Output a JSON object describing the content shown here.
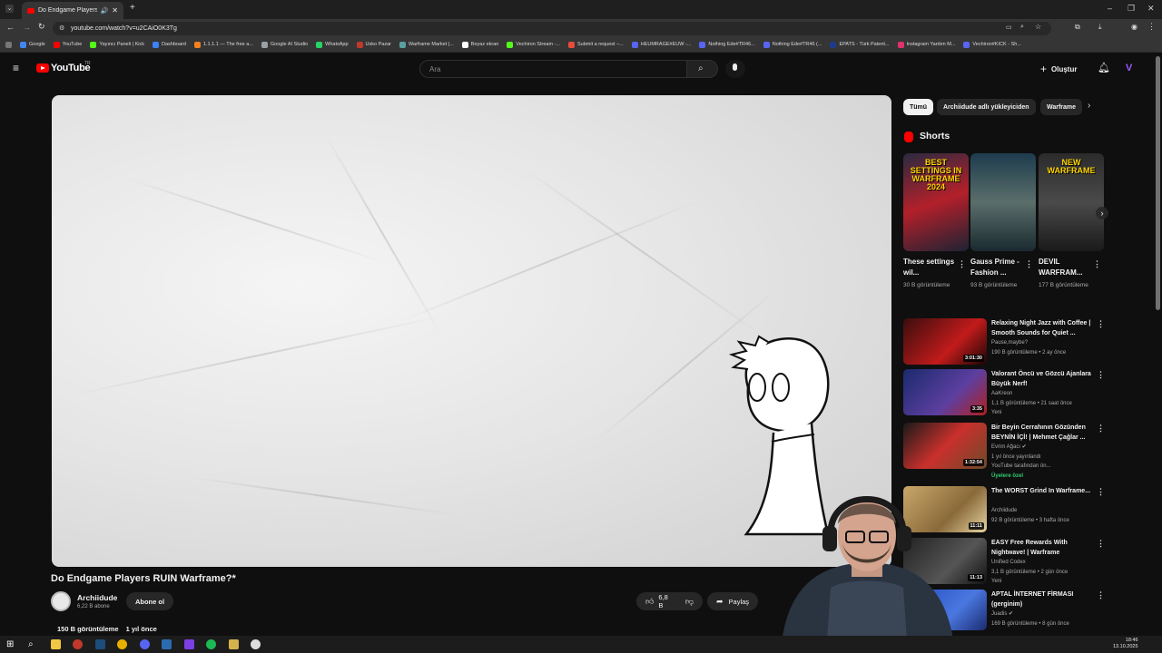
{
  "browser": {
    "tab_title": "Do Endgame Players RUIN",
    "url": "youtube.com/watch?v=u2CAiO0K3Tg",
    "bookmarks": [
      {
        "label": "Google",
        "color": "#4285f4"
      },
      {
        "label": "YouTube",
        "color": "#ff0000"
      },
      {
        "label": "Yayıncı Paneli | Kick",
        "color": "#53fc18"
      },
      {
        "label": "Dashboard",
        "color": "#3b82f6"
      },
      {
        "label": "1.1.1.1 — The free a...",
        "color": "#f38020"
      },
      {
        "label": "Google AI Studio",
        "color": "#9aa0a6"
      },
      {
        "label": "WhatsApp",
        "color": "#25d366"
      },
      {
        "label": "Usko Pazar",
        "color": "#c0392b"
      },
      {
        "label": "Warframe Market |...",
        "color": "#5aa0a0"
      },
      {
        "label": "Beyaz ekran",
        "color": "#ffffff"
      },
      {
        "label": "Vechiron Stream -...",
        "color": "#53fc18"
      },
      {
        "label": "Submit a request –...",
        "color": "#e74c3c"
      },
      {
        "label": "HEUMRAGE#EUW -...",
        "color": "#5865f2"
      },
      {
        "label": "Nothing Ede#TR46...",
        "color": "#5865f2"
      },
      {
        "label": "Nothing Ede#TR46 (...",
        "color": "#5865f2"
      },
      {
        "label": "EPATS - Türk Patent...",
        "color": "#1e3a8a"
      },
      {
        "label": "Instagram Yardım M...",
        "color": "#e1306c"
      },
      {
        "label": "Vechiron#KICK - Sh...",
        "color": "#5865f2"
      }
    ]
  },
  "header": {
    "logo": "YouTube",
    "country": "TR",
    "search_placeholder": "Ara",
    "create_label": "Oluştur"
  },
  "video": {
    "title": "Do Endgame Players RUIN Warframe?*",
    "channel": "Archiidude",
    "subscribers": "6,22 B abone",
    "subscribe_label": "Abone ol",
    "likes": "6,8 B",
    "share_label": "Paylaş",
    "views": "150 B görüntüleme",
    "age": "1 yıl önce"
  },
  "chips": [
    "Tümü",
    "Archiidude adlı yükleyiciden",
    "Warframe"
  ],
  "shorts": {
    "heading": "Shorts",
    "items": [
      {
        "title": "These settings wil...",
        "views": "30 B görüntüleme",
        "overlay": "BEST SETTINGS IN WARFRAME 2024"
      },
      {
        "title": "Gauss Prime - Fashion ...",
        "views": "93 B görüntüleme",
        "overlay": ""
      },
      {
        "title": "DEVIL WARFRAM...",
        "views": "177 B görüntüleme",
        "overlay": "NEW WARFRAME"
      }
    ]
  },
  "recommendations": [
    {
      "title": "Relaxing Night Jazz with Coffee | Smooth Sounds for Quiet ...",
      "channel": "Pause,maybe?",
      "stats": "190 B görüntüleme • 2 ay önce",
      "extra": "",
      "duration": "3:01:30"
    },
    {
      "title": "Valorant Öncü ve Gözcü Ajanlara Büyük Nerf!",
      "channel": "AaKreon",
      "stats": "1,1 B görüntüleme • 21 saat önce",
      "extra": "Yeni",
      "duration": "3:35"
    },
    {
      "title": "Bir Beyin Cerrahının Gözünden BEYNİN İÇİ! | Mehmet Çağlar ...",
      "channel": "Evrim Ağacı ✔",
      "stats": "1 yıl önce yayınlandı",
      "extra": "YouTube tarafından ön...",
      "badge": "Üyelere özel",
      "duration": "1:32:54"
    },
    {
      "title": "The WORST Grind In Warframe...",
      "channel": "Archiidude",
      "stats": "92 B görüntüleme • 3 hafta önce",
      "extra": "",
      "duration": "11:11"
    },
    {
      "title": "EASY Free Rewards With Nightwave! | Warframe",
      "channel": "Unified Codex",
      "stats": "3,1 B görüntüleme • 2 gün önce",
      "extra": "Yeni",
      "duration": "11:13"
    },
    {
      "title": "APTAL İNTERNET FİRMASI (gerginim)",
      "channel": "Juadis ✔",
      "stats": "169 B görüntüleme • 8 gün önce",
      "extra": "",
      "duration": ""
    }
  ],
  "taskbar": {
    "time": "18:46",
    "date": "13.10.2025"
  }
}
